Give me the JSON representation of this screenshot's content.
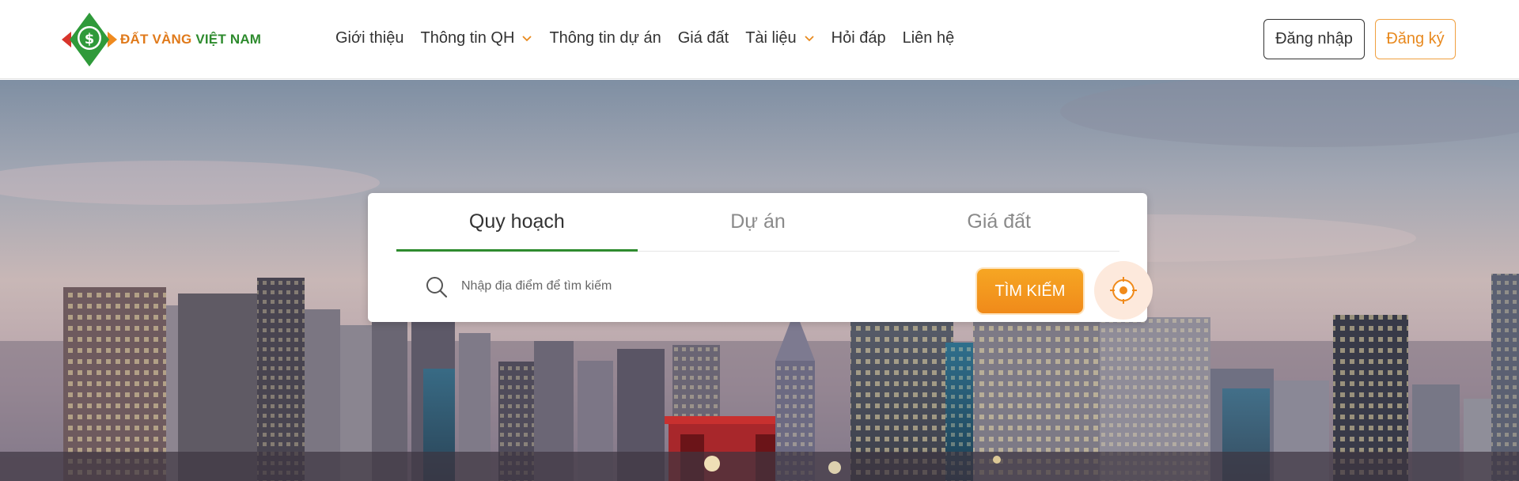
{
  "brand": {
    "name_part1": "ĐẤT VÀNG",
    "name_part2": "VIỆT NAM",
    "colors": {
      "orange": "#e07a1b",
      "green": "#2e8b2e",
      "accent": "#f08a1a"
    }
  },
  "nav": {
    "items": [
      {
        "label": "Giới thiệu",
        "has_dropdown": false
      },
      {
        "label": "Thông tin QH",
        "has_dropdown": true
      },
      {
        "label": "Thông tin dự án",
        "has_dropdown": false
      },
      {
        "label": "Giá đất",
        "has_dropdown": false
      },
      {
        "label": "Tài liệu",
        "has_dropdown": true
      },
      {
        "label": "Hỏi đáp",
        "has_dropdown": false
      },
      {
        "label": "Liên hệ",
        "has_dropdown": false
      }
    ],
    "login_label": "Đăng nhập",
    "register_label": "Đăng ký"
  },
  "search": {
    "tabs": [
      {
        "label": "Quy hoạch",
        "active": true
      },
      {
        "label": "Dự án",
        "active": false
      },
      {
        "label": "Giá đất",
        "active": false
      }
    ],
    "placeholder": "Nhập địa điểm để tìm kiếm",
    "button_label": "TÌM KIẾM",
    "icons": {
      "search": "search-icon",
      "locate": "locate-target-icon"
    }
  },
  "hero": {
    "background": "city-skyline-dusk"
  }
}
